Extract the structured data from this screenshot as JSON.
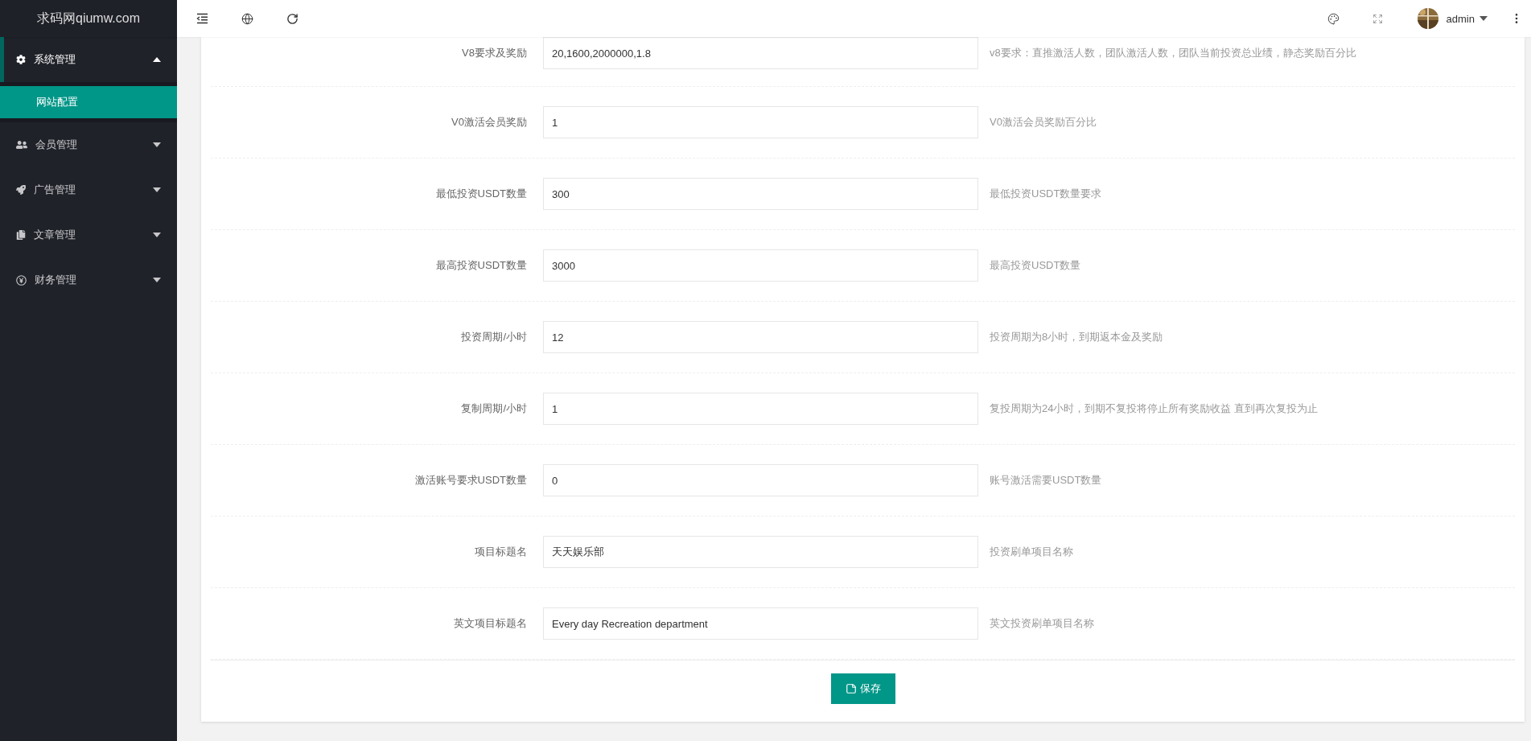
{
  "logo": "求码网qiumw.com",
  "user": {
    "name": "admin"
  },
  "sidebar": {
    "items": [
      {
        "label": "系统管理",
        "selected": true,
        "expanded": true,
        "children": [
          {
            "label": "网站配置",
            "selected": true
          }
        ]
      },
      {
        "label": "会员管理",
        "selected": false,
        "expanded": false
      },
      {
        "label": "广告管理",
        "selected": false,
        "expanded": false
      },
      {
        "label": "文章管理",
        "selected": false,
        "expanded": false
      },
      {
        "label": "财务管理",
        "selected": false,
        "expanded": false
      }
    ]
  },
  "form": {
    "rows": [
      {
        "label": "V8要求及奖励",
        "value": "20,1600,2000000,1.8",
        "hint": "v8要求：直推激活人数，团队激活人数，团队当前投资总业绩，静态奖励百分比"
      },
      {
        "label": "V0激活会员奖励",
        "value": "1",
        "hint": "V0激活会员奖励百分比"
      },
      {
        "label": "最低投资USDT数量",
        "value": "300",
        "hint": "最低投资USDT数量要求"
      },
      {
        "label": "最高投资USDT数量",
        "value": "3000",
        "hint": "最高投资USDT数量"
      },
      {
        "label": "投资周期/小时",
        "value": "12",
        "hint": "投资周期为8小时，到期返本金及奖励"
      },
      {
        "label": "复制周期/小时",
        "value": "1",
        "hint": "复投周期为24小时，到期不复投将停止所有奖励收益 直到再次复投为止"
      },
      {
        "label": "激活账号要求USDT数量",
        "value": "0",
        "hint": "账号激活需要USDT数量"
      },
      {
        "label": "项目标题名",
        "value": "天天娱乐部",
        "hint": "投资刷单项目名称"
      },
      {
        "label": "英文项目标题名",
        "value": "Every day Recreation department",
        "hint": "英文投资刷单项目名称"
      }
    ],
    "save_button": "保存"
  }
}
